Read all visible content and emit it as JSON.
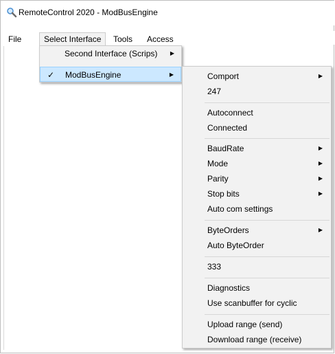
{
  "window": {
    "title": "RemoteControl 2020 - ModBusEngine"
  },
  "menubar": {
    "items": [
      {
        "label": "File"
      },
      {
        "label": "Select Interface"
      },
      {
        "label": "Tools"
      },
      {
        "label": "Access"
      }
    ]
  },
  "select_interface_menu": {
    "items": [
      {
        "label": "Second Interface (Scrips)",
        "has_submenu": true,
        "checked": false
      },
      {
        "label": "ModBusEngine",
        "has_submenu": true,
        "checked": true
      }
    ]
  },
  "modbus_submenu": {
    "items": [
      {
        "label": "Comport",
        "has_submenu": true
      },
      {
        "label": "247"
      },
      {
        "label": "Autoconnect"
      },
      {
        "label": "Connected"
      },
      {
        "label": "BaudRate",
        "has_submenu": true
      },
      {
        "label": "Mode",
        "has_submenu": true
      },
      {
        "label": "Parity",
        "has_submenu": true
      },
      {
        "label": "Stop bits",
        "has_submenu": true
      },
      {
        "label": "Auto com settings"
      },
      {
        "label": "ByteOrders",
        "has_submenu": true
      },
      {
        "label": "Auto ByteOrder"
      },
      {
        "label": "333"
      },
      {
        "label": "Diagnostics"
      },
      {
        "label": "Use scanbuffer for cyclic"
      },
      {
        "label": "Upload range (send)"
      },
      {
        "label": "Download range (receive)"
      }
    ]
  },
  "icons": {
    "app": "magnifier-icon",
    "check": "checkmark-icon",
    "submenu_arrow": "triangle-right-icon"
  },
  "colors": {
    "highlight": "#cce8ff",
    "menu_bg": "#f2f2f2"
  }
}
